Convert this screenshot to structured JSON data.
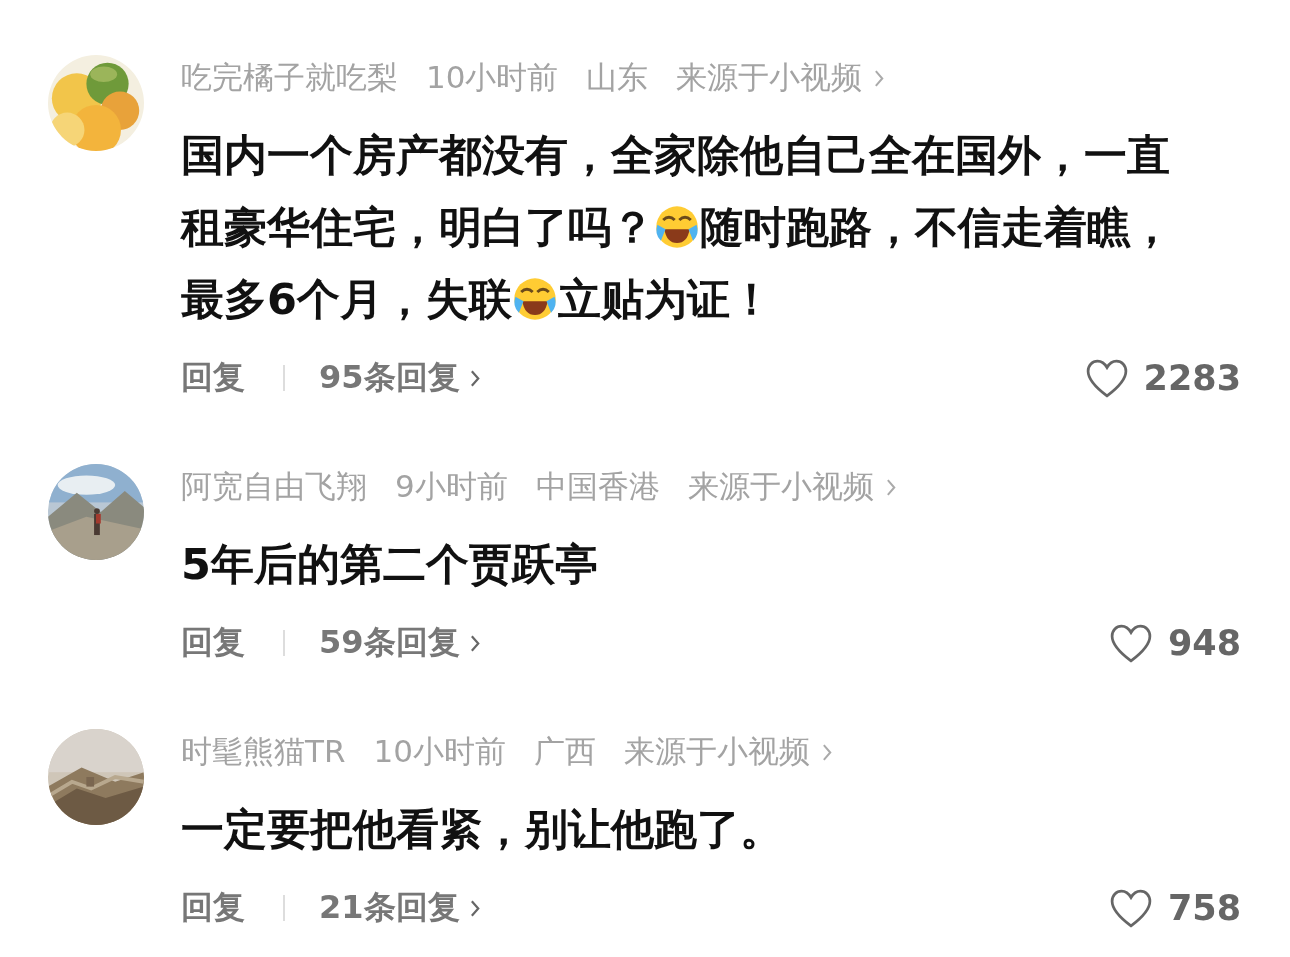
{
  "comments": [
    {
      "user": "吃完橘子就吃梨",
      "time": "10小时前",
      "location": "山东",
      "source": "来源于小视频",
      "body": [
        [
          {
            "kind": "text",
            "text": "国内一个房产都没有，全家除他自己全在国外，一直"
          }
        ],
        [
          {
            "kind": "text",
            "text": "租豪华住宅，明白了吗？"
          },
          {
            "kind": "emoji"
          },
          {
            "kind": "text",
            "text": "随时跑路，不信走着瞧，"
          }
        ],
        [
          {
            "kind": "text",
            "text": "最多6个月，失联"
          },
          {
            "kind": "emoji"
          },
          {
            "kind": "text",
            "text": "立贴为证！"
          }
        ]
      ],
      "reply_label": "回复",
      "reply_count": "95条回复",
      "likes": "2283"
    },
    {
      "user": "阿宽自由飞翔",
      "time": "9小时前",
      "location": "中国香港",
      "source": "来源于小视频",
      "body": [
        [
          {
            "kind": "text",
            "text": "5年后的第二个贾跃亭"
          }
        ]
      ],
      "reply_label": "回复",
      "reply_count": "59条回复",
      "likes": "948"
    },
    {
      "user": "时髦熊猫TR",
      "time": "10小时前",
      "location": "广西",
      "source": "来源于小视频",
      "body": [
        [
          {
            "kind": "text",
            "text": "一定要把他看紧，别让他跑了。"
          }
        ]
      ],
      "reply_label": "回复",
      "reply_count": "21条回复",
      "likes": "758"
    }
  ]
}
